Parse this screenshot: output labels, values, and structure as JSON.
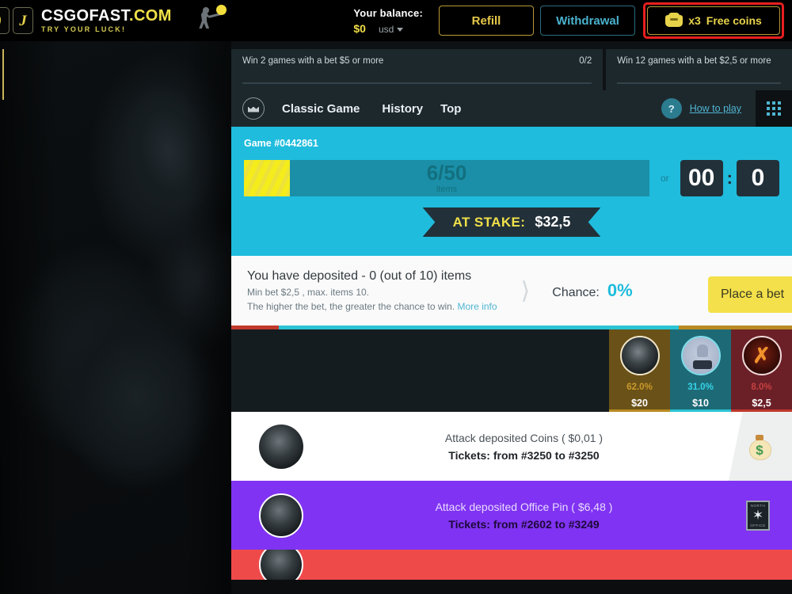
{
  "header": {
    "logo_main": "CSGOFAST",
    "logo_domain": ".COM",
    "logo_tagline": "TRY YOUR LUCK!",
    "balance_label": "Your balance:",
    "balance_amount": "$0",
    "currency": "usd",
    "refill_label": "Refill",
    "withdrawal_label": "Withdrawal",
    "free_coins_multiplier": "x3",
    "free_coins_label": "Free coins",
    "highlight_color": "#e81f1f",
    "accent_yellow": "#e8d44a",
    "accent_teal": "#4ab2cd"
  },
  "quests": [
    {
      "text": "Win 2 games with a bet $5 or more",
      "progress": "0/2"
    },
    {
      "text": "Win 12 games with a bet $2,5 or more",
      "progress": ""
    }
  ],
  "nav": {
    "crown_icon": "crown-icon",
    "items": [
      {
        "label": "Classic Game"
      },
      {
        "label": "History"
      },
      {
        "label": "Top"
      }
    ],
    "help_icon": "?",
    "help_label": "How to play",
    "grid_icon": "grid-dots-icon"
  },
  "game": {
    "game_id": "Game #0442861",
    "progress_value": "6/50",
    "progress_unit": "items",
    "progress_percent": 12,
    "or_label": "or",
    "timer_minutes": "00",
    "timer_seconds": "0",
    "stake_label": "AT STAKE:",
    "stake_value": "$32,5",
    "background_color": "#1fbcdd"
  },
  "deposit_panel": {
    "title": "You have deposited - 0 (out of 10) items",
    "sub_line1": "Min bet $2,5 , max. items 10.",
    "sub_line2": "The higher the bet, the greater the chance to win.",
    "more_info": "More info",
    "chance_label": "Chance:",
    "chance_value": "0%",
    "place_bet_label": "Place a bet"
  },
  "players": [
    {
      "percent": "62.0%",
      "amount": "$20",
      "color": "#b98a22",
      "avatar": "soldier-avatar"
    },
    {
      "percent": "31.0%",
      "amount": "$10",
      "color": "#2bc4d4",
      "avatar": "ghost-avatar"
    },
    {
      "percent": "8.0%",
      "amount": "$2,5",
      "color": "#c0392b",
      "avatar": "flame-avatar"
    }
  ],
  "deposit_rows": [
    {
      "line1": "Attack deposited Coins ( $0,01 )",
      "line2": "Tickets: from #3250 to #3250",
      "item_icon": "money-bag-icon",
      "row_color": "#ffffff"
    },
    {
      "line1": "Attack deposited Office Pin ( $6,48 )",
      "line2": "Tickets: from #2602 to #3249",
      "item_icon": "office-pin-icon",
      "item_top_text": "NORTH",
      "item_bottom_text": "OFFICE",
      "row_color": "#8033f2"
    },
    {
      "line1": "",
      "line2": "",
      "item_icon": "item-icon",
      "row_color": "#ef4a4a"
    }
  ]
}
